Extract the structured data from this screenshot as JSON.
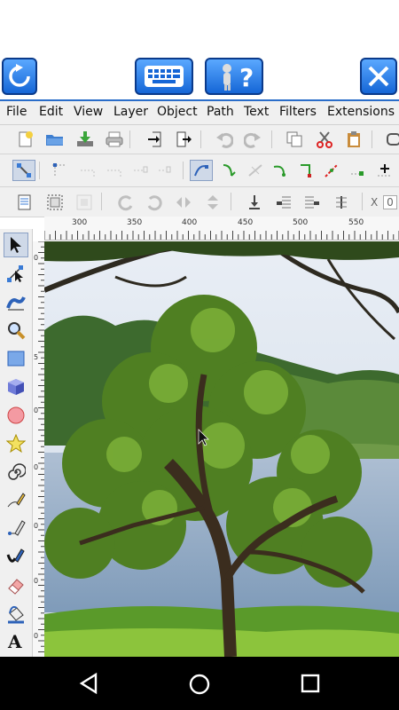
{
  "topbar": {
    "refresh_icon": "refresh-icon",
    "keyboard_icon": "keyboard-icon",
    "help_icon": "help-icon",
    "close_icon": "close-icon"
  },
  "menu": {
    "items": [
      "File",
      "Edit",
      "View",
      "Layer",
      "Object",
      "Path",
      "Text",
      "Filters",
      "Extensions"
    ]
  },
  "ruler": {
    "h_labels": [
      "300",
      "350",
      "400",
      "450",
      "500",
      "550"
    ],
    "v_labels": [
      "0",
      "5",
      "0",
      "0",
      "0",
      "0",
      "0"
    ]
  },
  "toolbar3": {
    "x_label": "X",
    "x_value": "0"
  },
  "colors": {
    "accent": "#2a6dc9",
    "toolbar_bg": "#f0f0f0",
    "navbar_bg": "#000000"
  }
}
